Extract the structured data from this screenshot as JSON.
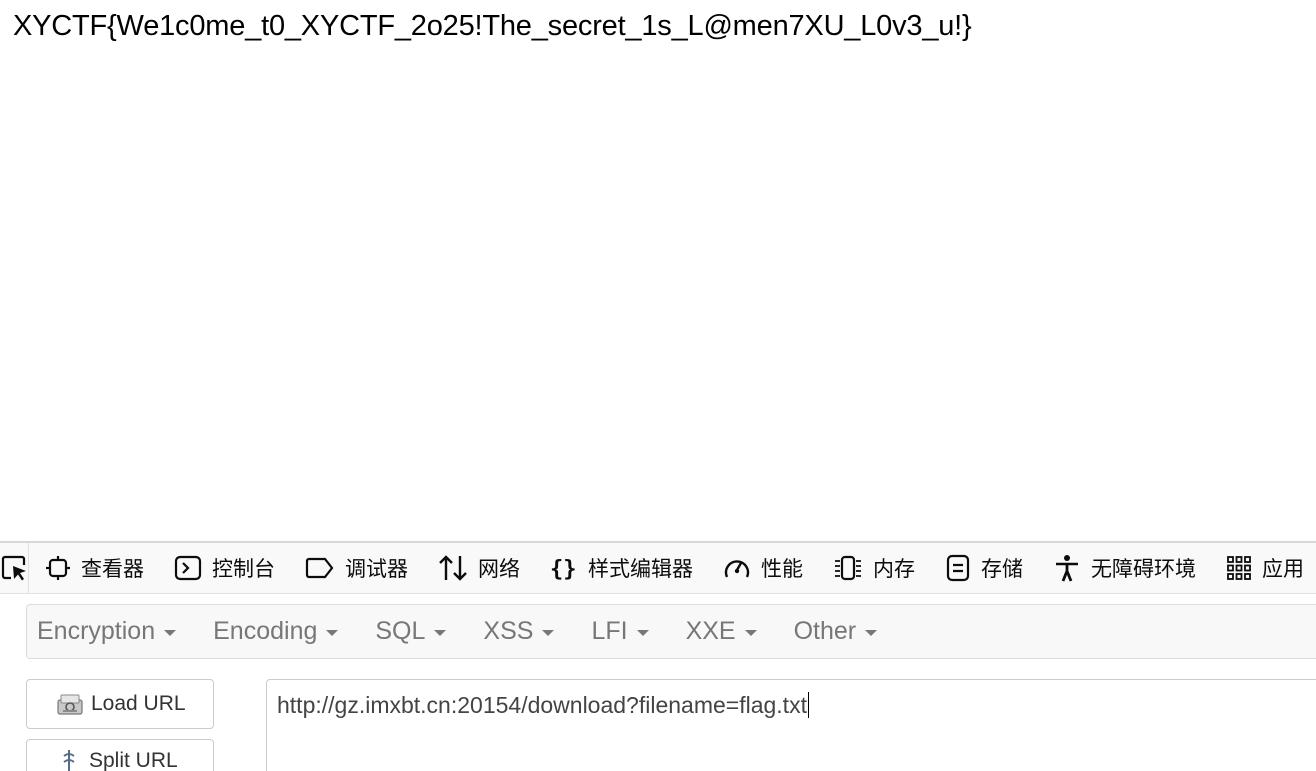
{
  "page": {
    "flag_text": "XYCTF{We1c0me_t0_XYCTF_2o25!The_secret_1s_L@men7XU_L0v3_u!}"
  },
  "devtools": {
    "tabs": [
      {
        "label": "查看器",
        "icon": "inspector-icon"
      },
      {
        "label": "控制台",
        "icon": "console-icon"
      },
      {
        "label": "调试器",
        "icon": "debugger-icon"
      },
      {
        "label": "网络",
        "icon": "network-icon"
      },
      {
        "label": "样式编辑器",
        "icon": "style-editor-icon"
      },
      {
        "label": "性能",
        "icon": "performance-icon"
      },
      {
        "label": "内存",
        "icon": "memory-icon"
      },
      {
        "label": "存储",
        "icon": "storage-icon"
      },
      {
        "label": "无障碍环境",
        "icon": "accessibility-icon"
      },
      {
        "label": "应用",
        "icon": "application-icon"
      }
    ]
  },
  "hackbar": {
    "menu": [
      "Encryption",
      "Encoding",
      "SQL",
      "XSS",
      "LFI",
      "XXE",
      "Other"
    ],
    "load_url_label": "Load URL",
    "split_url_label": "Split URL",
    "url_value": "http://gz.imxbt.cn:20154/download?filename=flag.txt"
  }
}
